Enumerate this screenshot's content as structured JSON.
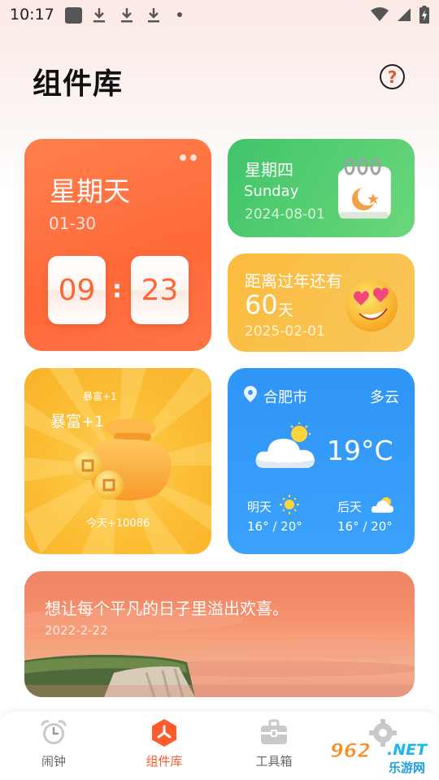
{
  "status_bar": {
    "time": "10:17"
  },
  "header": {
    "title": "组件库",
    "help_symbol": "?"
  },
  "week_card": {
    "weekday": "星期天",
    "date": "01-30",
    "hour": "09",
    "separator": ":",
    "minute": "23"
  },
  "date_card": {
    "weekday": "星期四",
    "weekday_en": "Sunday",
    "date": "2024-08-01"
  },
  "countdown_card": {
    "label": "距离过年还有",
    "days": "60",
    "unit": "天",
    "date": "2025-02-01"
  },
  "rich_card": {
    "small_text": "暴富+1",
    "big_text": "暴富+1",
    "today_text": "今天+10086"
  },
  "weather_card": {
    "city": "合肥市",
    "condition": "多云",
    "temperature": "19°C",
    "tomorrow_label": "明天",
    "tomorrow_temp": "16° / 20°",
    "after_label": "后天",
    "after_temp": "16° / 20°"
  },
  "quote_card": {
    "text": "想让每个平凡的日子里溢出欢喜。",
    "date": "2022-2-22"
  },
  "bottom_nav": {
    "items": [
      {
        "label": "闹钟",
        "icon": "alarm-clock-icon"
      },
      {
        "label": "组件库",
        "icon": "widget-icon",
        "active": true
      },
      {
        "label": "工具箱",
        "icon": "toolbox-icon"
      },
      {
        "label": "",
        "icon": "gear-icon"
      }
    ]
  },
  "watermark": {
    "num": "962",
    "net": ".NET",
    "cn": "乐游网"
  },
  "colors": {
    "accent": "#ff5a2c",
    "week_card": "#ff7446",
    "date_card": "#4cc96e",
    "countdown_card": "#fbbf45",
    "rich_card": "#fbbd33",
    "weather_card": "#3399f8",
    "quote_card": "#f4967a"
  }
}
